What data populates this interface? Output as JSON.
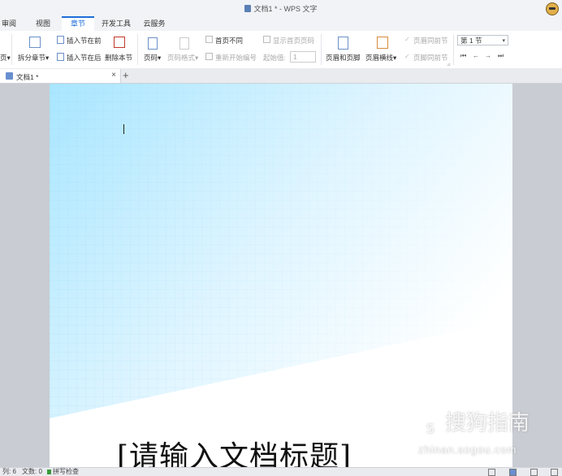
{
  "window": {
    "title": "文档1 * - WPS 文字",
    "doc_icon": "wps-writer-doc-icon",
    "avatar_icon": "user-avatar-icon"
  },
  "menu": [
    {
      "label": "审阅",
      "active": false
    },
    {
      "label": "视图",
      "active": false
    },
    {
      "label": "章节",
      "active": true
    },
    {
      "label": "开发工具",
      "active": false
    },
    {
      "label": "云服务",
      "active": false
    }
  ],
  "ribbon": {
    "cutoff_label": "页",
    "split_section": "拆分章节",
    "insert_before": "插入节在前",
    "insert_after": "插入节在后",
    "delete_section": "删除本节",
    "page_number": "页码",
    "page_number_format": "页码格式",
    "first_page_different": "首页不同",
    "restart_numbering": "重新开始编号",
    "start_value_label": "起始值:",
    "start_value": "1",
    "show_first_page_number": "显示首页页码",
    "header_footer": "页眉和页脚",
    "header_line": "页眉横线",
    "header_same_as_previous": "页眉同前节",
    "footer_same_as_previous": "页脚同前节",
    "section_select": "第 1 节",
    "nav_first": "⏮",
    "nav_prev": "←",
    "nav_next": "→",
    "nav_last": "⏭",
    "dropdown_arrow": "▾",
    "dialog_launcher": "⊿"
  },
  "tabs": {
    "doc_tab_label": "文档1 *",
    "close": "×",
    "new_tab": "+"
  },
  "document": {
    "title_placeholder": "[请输入文档标题]"
  },
  "watermark": {
    "logo_glyph": "S",
    "brand": "搜狗指南",
    "url": "zhinan.sogou.com"
  },
  "status": {
    "column": "列: 6",
    "word_count": "文数: 0",
    "spell_check": "拼写检查"
  },
  "colors": {
    "accent": "#1e6fd9",
    "cover_blue": "#bfeaff"
  }
}
